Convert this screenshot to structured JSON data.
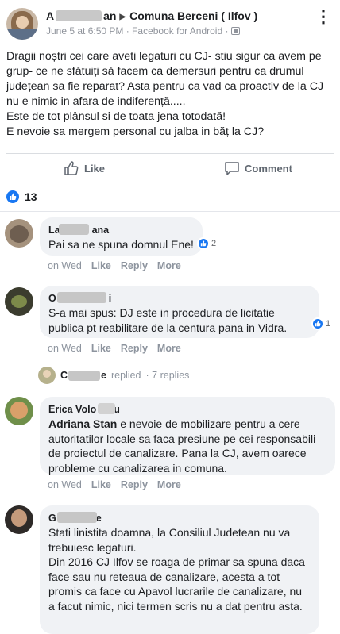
{
  "post": {
    "author": "A",
    "author_suffix": "an",
    "group": "Comuna Berceni ( Ilfov )",
    "meta": "June 5 at 6:50 PM · Facebook for Android ·",
    "body": "Dragii noștri cei care aveti legaturi cu CJ- stiu sigur ca avem pe grup- ce ne sfătuiți să facem ca demersuri pentru ca drumul județean sa fie reparat? Asta pentru ca vad ca proactiv de la CJ nu e nimic in afara de indiferență.....\nEste de tot plânsul si de toata jena totodată!\nE nevoie sa mergem personal cu jalba in băț la CJ?",
    "like_label": "Like",
    "comment_label": "Comment",
    "reaction_count": "13"
  },
  "comments": [
    {
      "name": "La",
      "name_tail": "ana",
      "text": "Pai sa ne spuna domnul Ene!",
      "reactions": "2",
      "time": "on Wed",
      "like": "Like",
      "reply": "Reply",
      "more": "More"
    },
    {
      "name": "O",
      "name_tail": "i",
      "text": "S-a mai spus: DJ este in procedura de licitatie publica pt reabilitare de la centura pana in Vidra.",
      "reactions": "1",
      "time": "on Wed",
      "like": "Like",
      "reply": "Reply",
      "more": "More"
    },
    {
      "name": "Erica Volo",
      "name_tail": "u",
      "mention": "Adriana Stan",
      "text": " e nevoie de mobilizare pentru a cere autoritatilor locale sa faca presiune pe cei responsabili de proiectul de canalizare. Pana la CJ, avem oarece probleme cu canalizarea in comuna.",
      "time": "on Wed",
      "like": "Like",
      "reply": "Reply",
      "more": "More"
    },
    {
      "name": "G",
      "name_tail": "e",
      "text": "Stati linistita doamna, la Consiliul Judetean nu va trebuiesc legaturi.\nDin 2016 CJ Ilfov se roaga de primar sa spuna daca face sau nu reteaua de canalizare, acesta a tot promis ca face cu Apavol lucrarile de canalizare, nu a facut nimic, nici termen scris nu a dat pentru asta."
    }
  ],
  "reply_summary": {
    "name": "C",
    "name_tail": "e",
    "replied": "replied",
    "count": "· 7 replies"
  },
  "colors": {
    "accent": "#1877f2",
    "bubble": "#f0f2f5",
    "muted": "#8d949e"
  },
  "icons": [
    "more-options-icon",
    "privacy-icon",
    "like-icon",
    "comment-icon",
    "like-reaction-icon"
  ]
}
